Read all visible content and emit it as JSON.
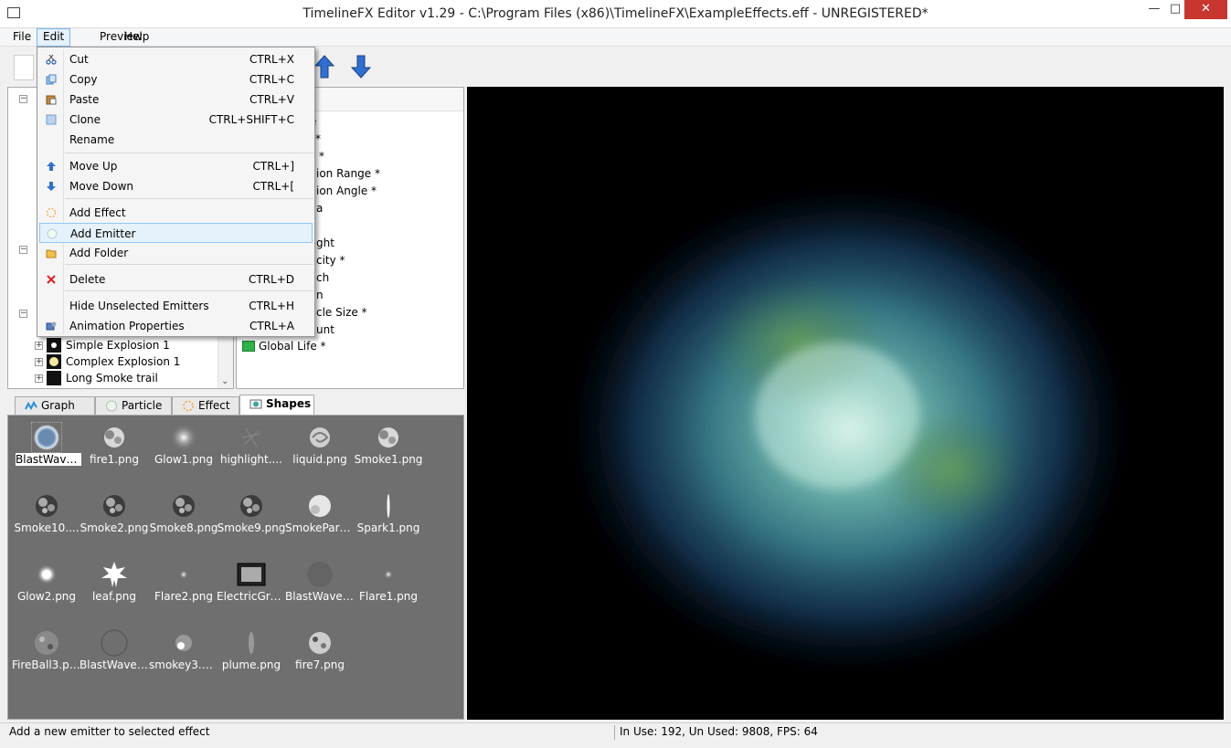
{
  "window": {
    "title": "TimelineFX Editor v1.29 - C:\\Program Files (x86)\\TimelineFX\\ExampleEffects.eff - UNREGISTERED*",
    "minimize": "—",
    "maximize": "□",
    "close": "✕"
  },
  "menubar": [
    "File",
    "Edit",
    "Preview",
    "Help"
  ],
  "edit_menu": {
    "items": [
      {
        "label": "Cut",
        "shortcut": "CTRL+X",
        "icon": "scissors-icon"
      },
      {
        "label": "Copy",
        "shortcut": "CTRL+C",
        "icon": "copy-icon"
      },
      {
        "label": "Paste",
        "shortcut": "CTRL+V",
        "icon": "paste-icon"
      },
      {
        "label": "Clone",
        "shortcut": "CTRL+SHIFT+C",
        "icon": "clone-icon"
      },
      {
        "label": "Rename",
        "shortcut": "",
        "icon": ""
      },
      {
        "label": "Move Up",
        "shortcut": "CTRL+]",
        "icon": "arrow-up-icon"
      },
      {
        "label": "Move Down",
        "shortcut": "CTRL+[",
        "icon": "arrow-down-icon"
      },
      {
        "label": "Add Effect",
        "shortcut": "",
        "icon": "effect-icon"
      },
      {
        "label": "Add Emitter",
        "shortcut": "",
        "icon": "emitter-icon"
      },
      {
        "label": "Add Folder",
        "shortcut": "",
        "icon": "folder-icon"
      },
      {
        "label": "Delete",
        "shortcut": "CTRL+D",
        "icon": "delete-icon"
      },
      {
        "label": "Hide Unselected Emitters",
        "shortcut": "CTRL+H",
        "icon": ""
      },
      {
        "label": "Animation Properties",
        "shortcut": "CTRL+A",
        "icon": "animation-icon"
      }
    ],
    "highlighted": "Add Emitter"
  },
  "tree": {
    "visible_items": [
      {
        "label": "Simple Explosion 1"
      },
      {
        "label": "Complex Explosion 1"
      },
      {
        "label": "Long Smoke trail"
      }
    ]
  },
  "properties": {
    "partial_items": [
      "e",
      "*",
      "*",
      "ion Range *",
      "ion Angle *",
      "a",
      "ght",
      "city *",
      "ch",
      "n",
      "cle Size *",
      "unt"
    ],
    "global_life": "Global Life *"
  },
  "tabs": [
    {
      "label": "Graph",
      "icon": "graph-icon"
    },
    {
      "label": "Particle",
      "icon": "particle-icon"
    },
    {
      "label": "Effect",
      "icon": "effect-icon"
    },
    {
      "label": "Shapes",
      "icon": "shapes-icon"
    }
  ],
  "active_tab": "Shapes",
  "shapes": [
    {
      "label": "BlastWave....",
      "kind": "ring"
    },
    {
      "label": "fire1.png",
      "kind": "cloud"
    },
    {
      "label": "Glow1.png",
      "kind": "glow"
    },
    {
      "label": "highlight....",
      "kind": "faint"
    },
    {
      "label": "liquid.png",
      "kind": "swirl"
    },
    {
      "label": "Smoke1.png",
      "kind": "cloud"
    },
    {
      "label": "Smoke10....",
      "kind": "dark-cloud"
    },
    {
      "label": "Smoke2.png",
      "kind": "dark-cloud"
    },
    {
      "label": "Smoke8.png",
      "kind": "dark-cloud"
    },
    {
      "label": "Smoke9.png",
      "kind": "dark-cloud"
    },
    {
      "label": "SmokePart....",
      "kind": "light-cloud"
    },
    {
      "label": "Spark1.png",
      "kind": "spark"
    },
    {
      "label": "Glow2.png",
      "kind": "bright-dot"
    },
    {
      "label": "leaf.png",
      "kind": "leaf"
    },
    {
      "label": "Flare2.png",
      "kind": "small-dot"
    },
    {
      "label": "ElectricGro....",
      "kind": "film"
    },
    {
      "label": "BlastWave4....",
      "kind": "dark-disc"
    },
    {
      "label": "Flare1.png",
      "kind": "small-dot"
    },
    {
      "label": "FireBall3.png",
      "kind": "noise"
    },
    {
      "label": "BlastWave9....",
      "kind": "ring-dark"
    },
    {
      "label": "smokey3.png",
      "kind": "smokey"
    },
    {
      "label": "plume.png",
      "kind": "plume"
    },
    {
      "label": "fire7.png",
      "kind": "noise-light"
    }
  ],
  "statusbar": {
    "hint": "Add a new emitter to selected effect",
    "stats": "In Use: 192, Un Used: 9808, FPS: 64"
  },
  "colors": {
    "viewport_bg": "#000000",
    "shapes_bg": "#6f6f6f",
    "menu_highlight": "#e5f1fb",
    "close_button": "#c7372f"
  }
}
